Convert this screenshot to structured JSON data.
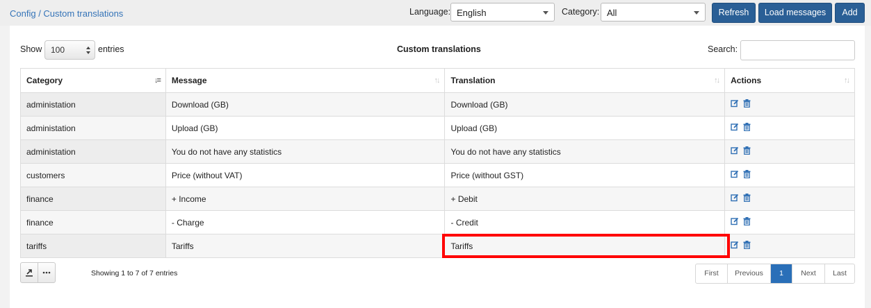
{
  "header": {
    "breadcrumb": "Config / Custom translations",
    "language_label": "Language:",
    "language_value": "English",
    "category_label": "Category:",
    "category_value": "All",
    "buttons": {
      "refresh": "Refresh",
      "load_messages": "Load messages",
      "add": "Add"
    }
  },
  "table_controls": {
    "show_label": "Show",
    "page_length": "100",
    "entries_label": "entries",
    "title": "Custom translations",
    "search_label": "Search:",
    "search_value": ""
  },
  "table": {
    "columns": [
      "Category",
      "Message",
      "Translation",
      "Actions"
    ],
    "rows": [
      {
        "category": "administation",
        "message": "Download (GB)",
        "translation": "Download (GB)"
      },
      {
        "category": "administation",
        "message": "Upload (GB)",
        "translation": "Upload (GB)"
      },
      {
        "category": "administation",
        "message": "You do not have any statistics",
        "translation": "You do not have any statistics"
      },
      {
        "category": "customers",
        "message": "Price (without VAT)",
        "translation": "Price (without GST)"
      },
      {
        "category": "finance",
        "message": "+ Income",
        "translation": "+ Debit"
      },
      {
        "category": "finance",
        "message": "- Charge",
        "translation": "- Credit"
      },
      {
        "category": "tariffs",
        "message": "Tariffs",
        "translation": "Tariffs"
      }
    ]
  },
  "footer": {
    "info": "Showing 1 to 7 of 7 entries",
    "pagination": {
      "first": "First",
      "previous": "Previous",
      "current": "1",
      "next": "Next",
      "last": "Last"
    }
  },
  "colors": {
    "primary": "#2a5f96",
    "link": "#3574b8",
    "highlight": "#ff0000",
    "page_active": "#2a6fb8"
  },
  "icons": {
    "edit": "edit-icon",
    "delete": "trash-icon",
    "export": "export-icon",
    "more": "more-icon"
  }
}
